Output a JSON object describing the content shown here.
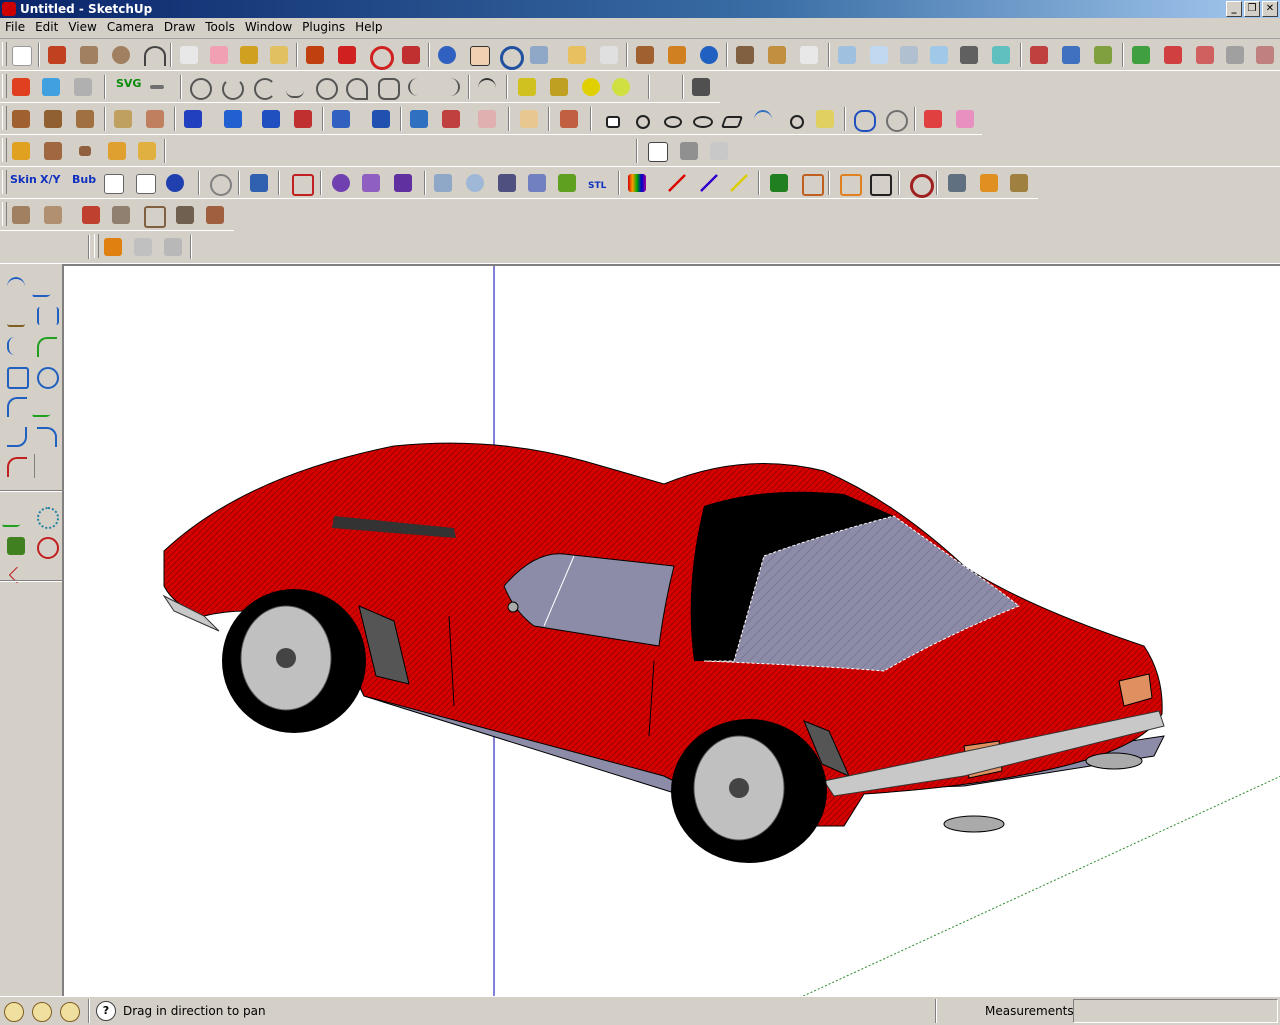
{
  "window": {
    "title": "Untitled - SketchUp"
  },
  "menu": [
    "File",
    "Edit",
    "View",
    "Camera",
    "Draw",
    "Tools",
    "Window",
    "Plugins",
    "Help"
  ],
  "toolbar": {
    "svg_label": "SVG",
    "skin_label": "Skin",
    "xy_label": "X/Y",
    "bub_label": "Bub",
    "stl_label": "STL"
  },
  "colors": {
    "car_body": "#d40000",
    "glass": "#8c8ca8",
    "axis_green": "#2a8a2a",
    "axis_blue": "#0000b0"
  },
  "status": {
    "message": "Drag in direction to pan",
    "measurements_label": "Measurements",
    "measurements_value": ""
  }
}
